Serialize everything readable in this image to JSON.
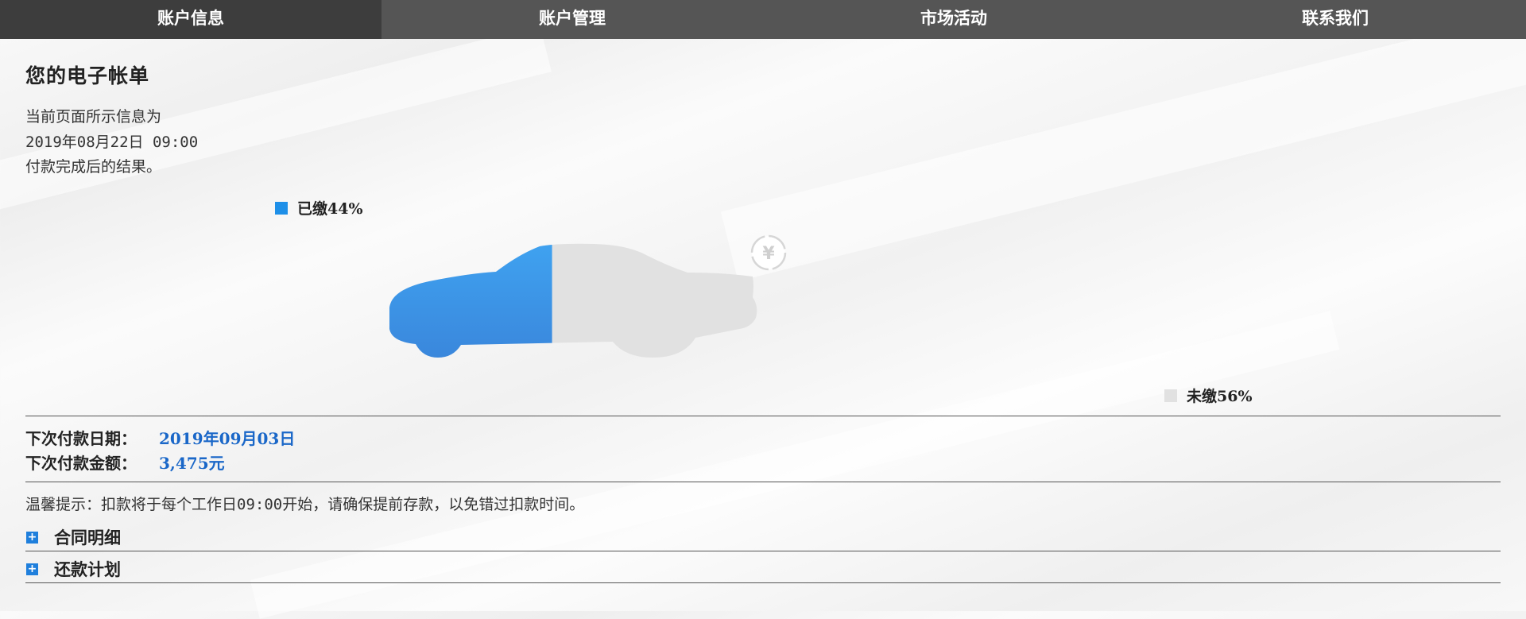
{
  "nav": {
    "tabs": [
      {
        "label": "账户信息",
        "active": true
      },
      {
        "label": "账户管理",
        "active": false
      },
      {
        "label": "市场活动",
        "active": false
      },
      {
        "label": "联系我们",
        "active": false
      }
    ]
  },
  "page": {
    "title": "您的电子帐单",
    "info_lines": [
      "当前页面所示信息为",
      "2019年08月22日 09:00",
      "付款完成后的结果。"
    ]
  },
  "progress": {
    "paid": {
      "label": "已缴44%",
      "percent": 44,
      "color": "#1e8fe8"
    },
    "unpaid": {
      "label": "未缴56%",
      "percent": 56,
      "color": "#e1e1e1"
    },
    "icon": "yen-refresh-icon"
  },
  "payment": {
    "next_date_label": "下次付款日期：",
    "next_date_value": "2019年09月03日",
    "next_amount_label": "下次付款金额：",
    "next_amount_value": "3,475元"
  },
  "hint": "温馨提示：扣款将于每个工作日09:00开始，请确保提前存款，以免错过扣款时间。",
  "sections": [
    {
      "label": "合同明细",
      "icon": "plus-icon"
    },
    {
      "label": "还款计划",
      "icon": "plus-icon"
    }
  ]
}
